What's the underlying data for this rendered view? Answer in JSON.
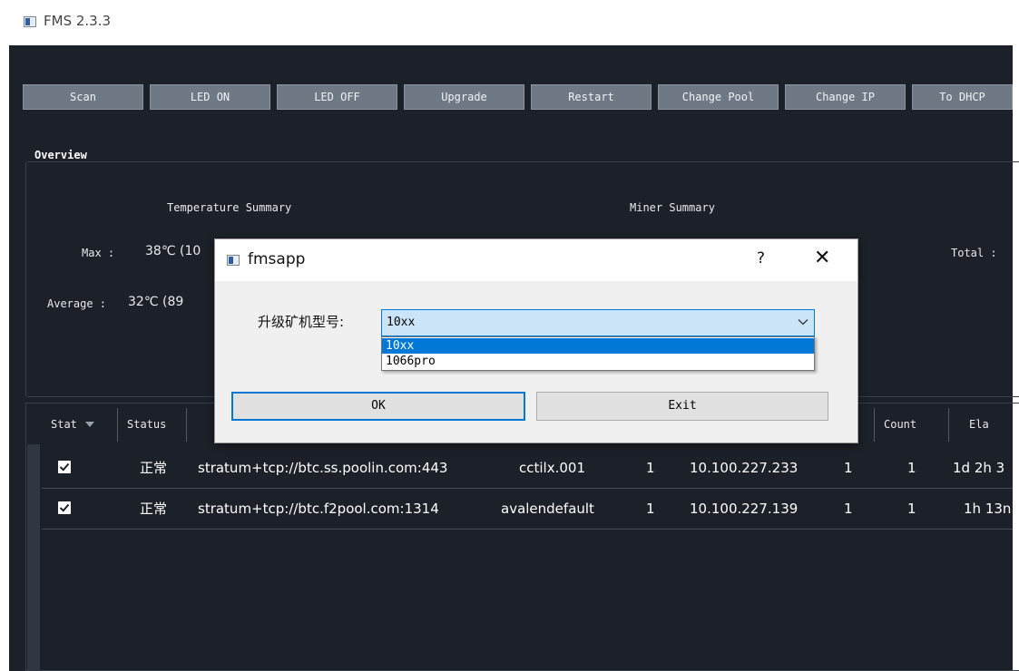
{
  "app": {
    "title": "FMS 2.3.3"
  },
  "toolbar": {
    "buttons": [
      "Scan",
      "LED ON",
      "LED OFF",
      "Upgrade",
      "Restart",
      "Change Pool",
      "Change IP",
      "To DHCP"
    ]
  },
  "overview": {
    "title": "Overview",
    "temperature_summary": "Temperature Summary",
    "miner_summary": "Miner Summary",
    "max_label": "Max :",
    "max_value": "38℃ (10",
    "average_label": "Average :",
    "average_value": "32℃ (89",
    "total_label": "Total :"
  },
  "table": {
    "columns": [
      "Stat",
      "Status",
      "",
      "",
      "",
      "",
      "",
      "Count",
      "Ela"
    ],
    "rows": [
      {
        "checked": true,
        "status": "正常",
        "pool": "stratum+tcp://btc.ss.poolin.com:443",
        "worker": "cctilx.001",
        "c1": "1",
        "ip": "10.100.227.233",
        "c2": "1",
        "count": "1",
        "elapsed": "1d 2h 3"
      },
      {
        "checked": true,
        "status": "正常",
        "pool": "stratum+tcp://btc.f2pool.com:1314",
        "worker": "avalendefault",
        "c1": "1",
        "ip": "10.100.227.139",
        "c2": "1",
        "count": "1",
        "elapsed": "1h 13n"
      }
    ]
  },
  "dialog": {
    "title": "fmsapp",
    "help": "?",
    "close": "✕",
    "model_label": "升级矿机型号:",
    "model_selected": "10xx",
    "model_options": [
      "10xx",
      "1066pro"
    ],
    "ok_label": "OK",
    "exit_label": "Exit"
  },
  "colors": {
    "window_bg": "#1c2028",
    "button_bg": "#6f7885",
    "accent": "#0078d7",
    "select_bg": "#cce4f7"
  }
}
